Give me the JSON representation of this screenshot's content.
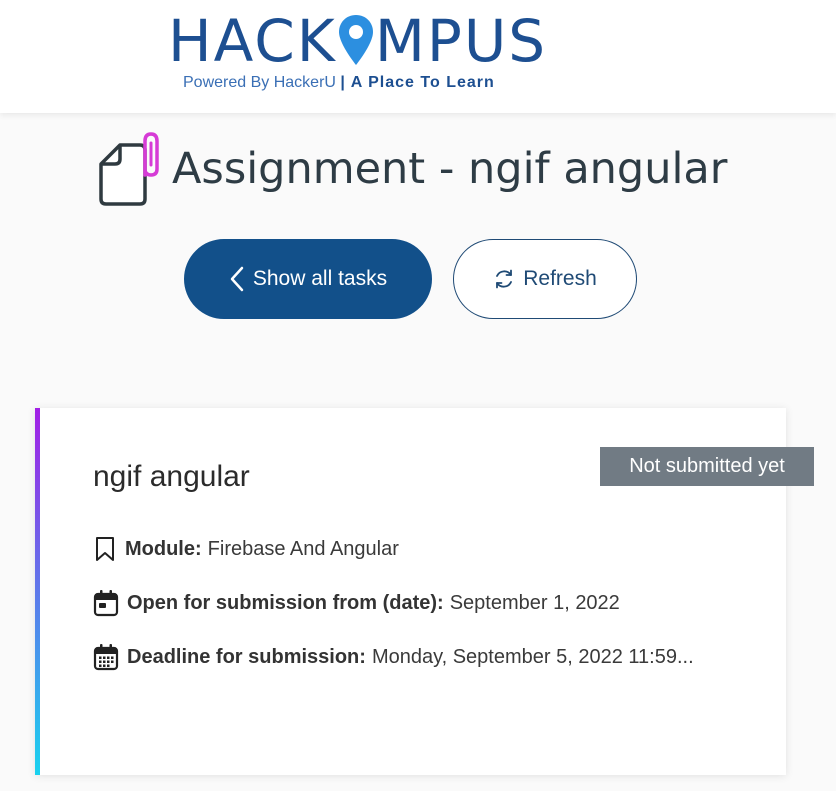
{
  "logo": {
    "word_left": "HACK",
    "word_right": "MPUS",
    "tagline_normal": "Powered By HackerU ",
    "tagline_strong": "| A Place To Learn"
  },
  "page": {
    "title": "Assignment - ngif angular"
  },
  "buttons": {
    "show_all_tasks": "Show all tasks",
    "refresh": "Refresh"
  },
  "card": {
    "title": "ngif angular",
    "status": "Not submitted yet",
    "module_label": "Module:",
    "module_value": "Firebase And Angular",
    "open_label": "Open for submission from (date):",
    "open_value": "September 1, 2022",
    "deadline_label": "Deadline for submission:",
    "deadline_value": "Monday, September 5, 2022 11:59..."
  },
  "colors": {
    "brand": "#1d4f91",
    "primary_button": "#12508a",
    "badge": "#717b84",
    "gradient_top": "#a21fe6",
    "gradient_bottom": "#19d2ef",
    "paperclip": "#d63bd6"
  },
  "icons": {
    "back": "chevron-left-icon",
    "refresh": "refresh-icon",
    "module": "bookmark-icon",
    "open_date": "calendar-event-icon",
    "deadline": "calendar-grid-icon",
    "title": "document-paperclip-icon"
  }
}
